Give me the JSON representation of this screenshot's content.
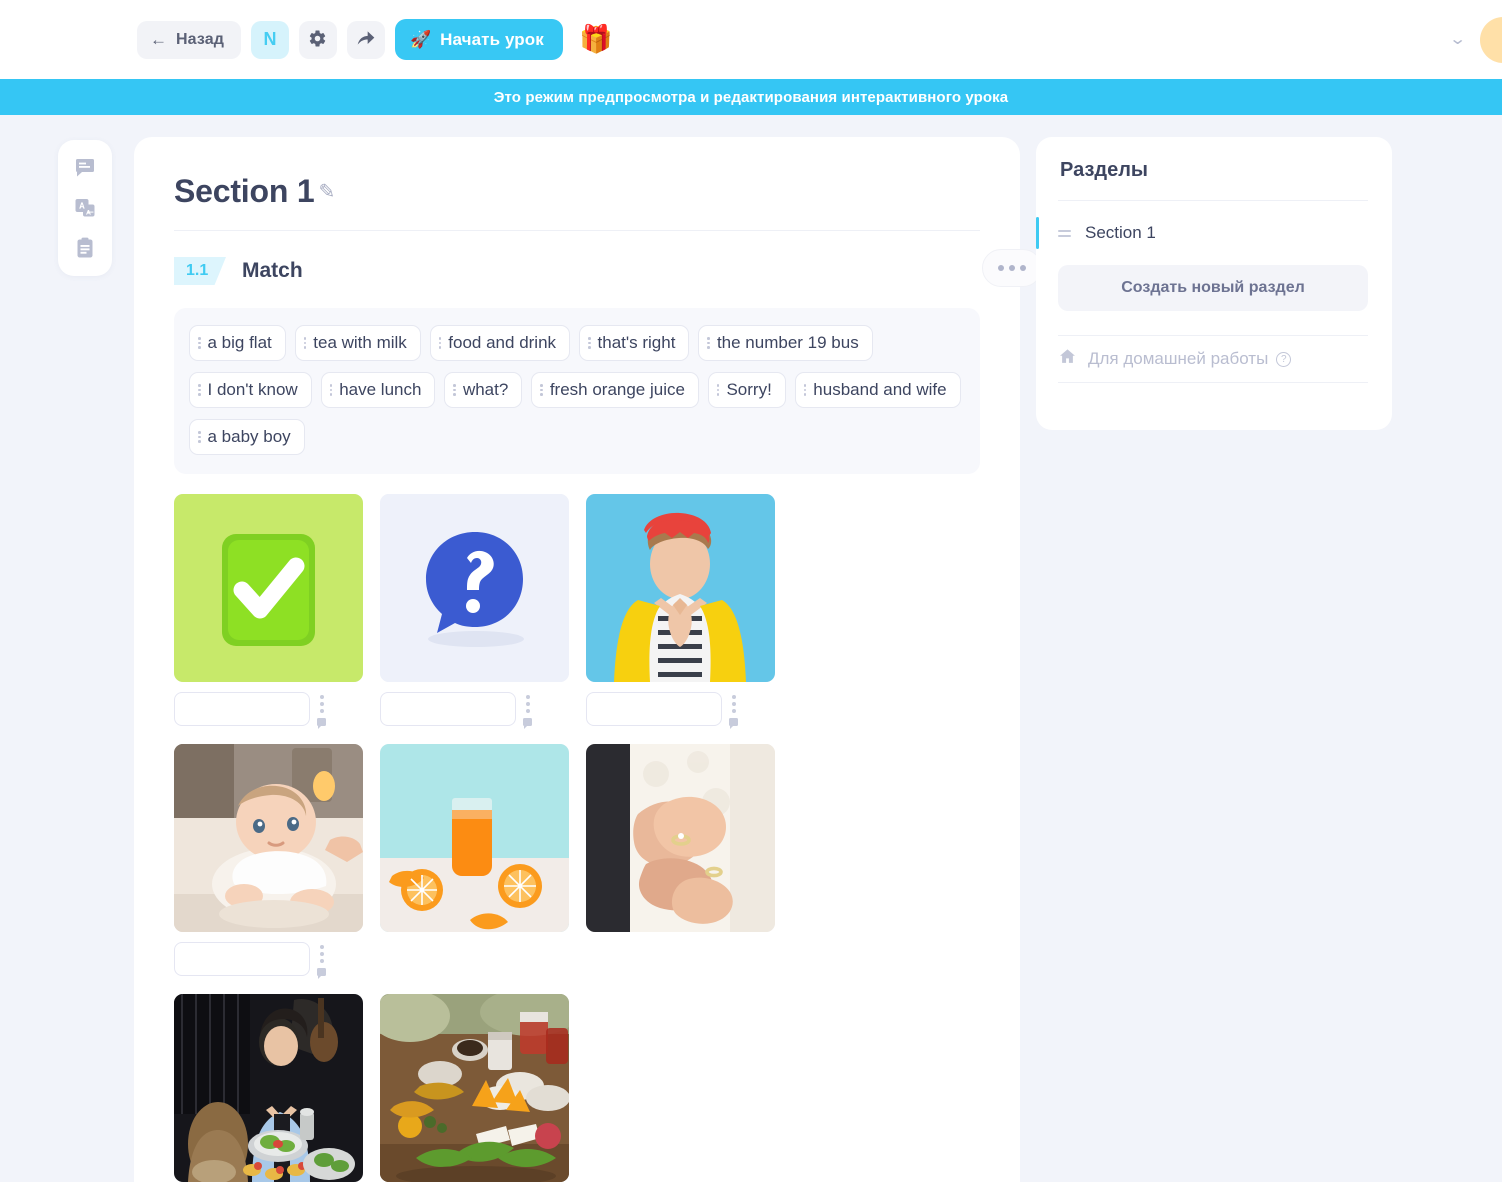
{
  "topbar": {
    "back_label": "Назад",
    "back_icon": "arrow-left-icon",
    "language_badge": "N",
    "settings_icon": "gear-icon",
    "share_icon": "share-arrow-icon",
    "start_lesson_label": "Начать урок",
    "rocket_icon": "rocket-icon",
    "gift_icon": "gift-icon",
    "chevron_icon": "chevron-down-icon",
    "accent_color": "#38c8f4"
  },
  "banner": {
    "text": "Это режим предпросмотра и редактирования интерактивного урока",
    "background": "#35c6f4"
  },
  "rail": {
    "items": [
      {
        "icon": "comment-bubble-icon",
        "name": "comments-tool"
      },
      {
        "icon": "translate-icon",
        "name": "translate-tool"
      },
      {
        "icon": "clipboard-icon",
        "name": "clipboard-tool"
      }
    ]
  },
  "main": {
    "section_title": "Section 1",
    "edit_icon": "pencil-icon",
    "task": {
      "number": "1.1",
      "title": "Match",
      "more_icon": "ellipsis-icon"
    },
    "chips": [
      "a big flat",
      "tea with milk",
      "food and drink",
      "that's right",
      "the number 19 bus",
      "I don't know",
      "have lunch",
      "what?",
      "fresh orange juice",
      "Sorry!",
      "husband and wife",
      "a baby boy"
    ],
    "items": [
      {
        "alt": "green check mark 3d icon",
        "answer": "",
        "placeholder": ""
      },
      {
        "alt": "blue question mark speech bubble 3d icon",
        "answer": "",
        "placeholder": ""
      },
      {
        "alt": "woman in yellow jacket and red beanie with hands clasped",
        "answer": "",
        "placeholder": ""
      },
      {
        "alt": "baby lying on a rug",
        "answer": "",
        "placeholder": ""
      },
      {
        "alt": "bottle of fresh orange juice with orange slices",
        "alt_row": 2
      },
      {
        "alt": "bride and groom hands with wedding rings",
        "alt_row": 2
      },
      {
        "alt": "woman having lunch at a table with friends",
        "alt_row": 2
      },
      {
        "alt": "table spread with food and drink",
        "alt_row": 2
      }
    ]
  },
  "right_panel": {
    "title": "Разделы",
    "sections": [
      {
        "label": "Section 1",
        "active": true,
        "grip_icon": "drag-handle-icon"
      }
    ],
    "create_label": "Создать новый раздел",
    "homework": {
      "icon": "home-icon",
      "label": "Для домашней работы",
      "help_icon": "question-circle-icon",
      "help_glyph": "?"
    },
    "active_color": "#3ecaf2"
  }
}
